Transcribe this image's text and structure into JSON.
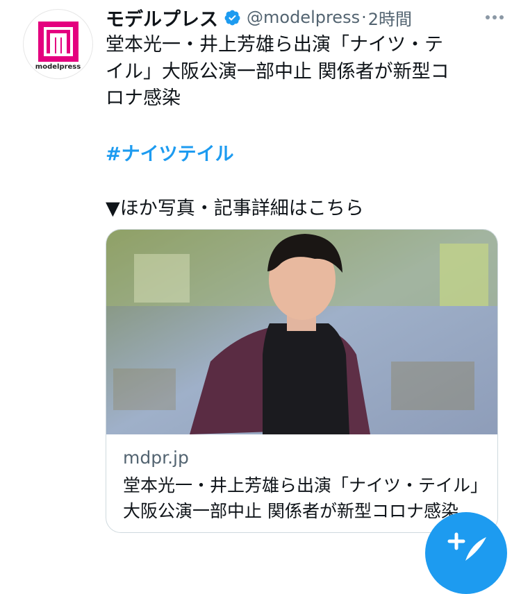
{
  "account": {
    "logo_text": "modelpress",
    "name": "モデルプレス",
    "handle": "@modelpress",
    "separator": "·",
    "time": "2時間"
  },
  "tweet": {
    "lines": [
      "堂本光一・井上芳雄ら出演「ナイツ・テ",
      "イル」大阪公演一部中止 関係者が新型コ",
      "ロナ感染"
    ],
    "hashtag": "#ナイツテイル",
    "link_intro": "▼ほか写真・記事詳細はこちら"
  },
  "card": {
    "domain": "mdpr.jp",
    "title": "堂本光一・井上芳雄ら出演「ナイツ・テイル」大阪公演一部中止 関係者が新型コロナ感染"
  },
  "colors": {
    "accent": "#1d9bf0",
    "brand": "#e4007f",
    "secondary_text": "#536471"
  },
  "icons": [
    "verified-badge-icon",
    "more-icon",
    "compose-icon"
  ]
}
